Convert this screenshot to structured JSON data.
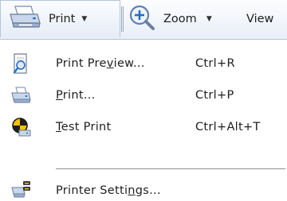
{
  "toolbar": {
    "print_label": "Print",
    "zoom_label": "Zoom",
    "view_label": "View"
  },
  "menu": {
    "items": [
      {
        "label_before": "Print Pre",
        "label_mnemonic": "v",
        "label_after": "iew...",
        "shortcut": "Ctrl+R",
        "icon": "print-preview-icon"
      },
      {
        "label_before": "",
        "label_mnemonic": "P",
        "label_after": "rint...",
        "shortcut": "Ctrl+P",
        "icon": "printer-icon"
      },
      {
        "label_before": "",
        "label_mnemonic": "T",
        "label_after": "est Print",
        "shortcut": "Ctrl+Alt+T",
        "icon": "test-print-icon"
      },
      {
        "label_before": "Printer Setti",
        "label_mnemonic": "n",
        "label_after": "gs...",
        "shortcut": "",
        "icon": "printer-settings-icon"
      }
    ]
  },
  "colors": {
    "toolbar_border": "#b4c4dc",
    "separator": "#8e8e8e",
    "accent_blue": "#2b6cc4"
  }
}
